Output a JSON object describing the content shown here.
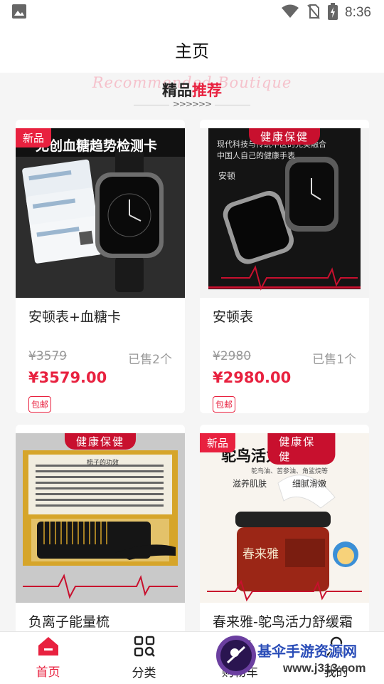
{
  "status_bar": {
    "time": "8:36"
  },
  "header": {
    "title": "主页"
  },
  "section": {
    "bg_text": "Recommended Boutique",
    "title_part1": "精品",
    "title_part2": "推荐",
    "arrows": ">>>>>>"
  },
  "products": [
    {
      "name": "安顿表+血糖卡",
      "orig_price": "¥3579",
      "sold": "已售2个",
      "price": "¥3579.00",
      "badge": "包邮",
      "tag": "新品",
      "image_title": "无创血糖趋势检测卡"
    },
    {
      "name": "安顿表",
      "orig_price": "¥2980",
      "sold": "已售1个",
      "price": "¥2980.00",
      "badge": "包邮",
      "tag": "健康保健",
      "image_line1": "现代科技与传统中医的完美融合",
      "image_line2": "中国人自己的健康手表",
      "image_brand": "安顿"
    },
    {
      "name": "负离子能量梳",
      "tag": "健康保健",
      "image_caption": "梳子的功效"
    },
    {
      "name": "春来雅-鸵鸟活力舒缓霜",
      "tag": "新品",
      "tag2": "健康保健",
      "image_title": "鸵鸟活力舒缓霜",
      "image_sub": "鸵鸟油、苦参油、角鲨烷等",
      "image_f1": "滋养肌肤",
      "image_f2": "细腻滑嫩",
      "image_jar": "春来雅"
    }
  ],
  "tabbar": {
    "items": [
      {
        "label": "首页",
        "icon": "home-icon"
      },
      {
        "label": "分类",
        "icon": "grid-search-icon"
      },
      {
        "label": "购物车",
        "icon": "cart-icon"
      },
      {
        "label": "我的",
        "icon": "user-icon"
      }
    ]
  },
  "watermark": {
    "text": "基伞手游资源网",
    "url": "www.j313.com"
  },
  "colors": {
    "accent": "#e8213f",
    "health_tag": "#c8102e"
  }
}
